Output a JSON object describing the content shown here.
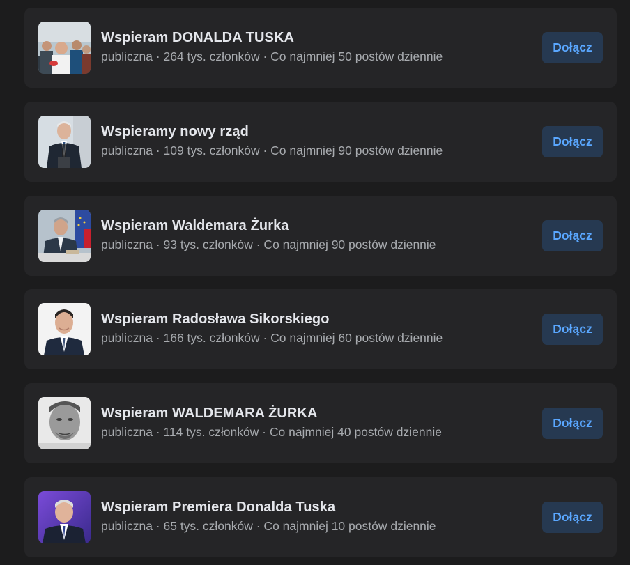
{
  "groups": [
    {
      "name": "Wspieram DONALDA TUSKA",
      "meta": "publiczna · 264 tys. członków · Co najmniej 50 postów dziennie",
      "join_label": "Dołącz",
      "photo": "crowd-photo-icon"
    },
    {
      "name": "Wspieramy nowy rząd",
      "meta": "publiczna · 109 tys. członków · Co najmniej 90 postów dziennie",
      "join_label": "Dołącz",
      "photo": "speaker-at-podium-photo-icon"
    },
    {
      "name": "Wspieram Waldemara Żurka",
      "meta": "publiczna · 93 tys. członków · Co najmniej 90 postów dziennie",
      "join_label": "Dołącz",
      "photo": "man-with-flags-photo-icon"
    },
    {
      "name": "Wspieram Radosława Sikorskiego",
      "meta": "publiczna · 166 tys. członków · Co najmniej 60 postów dziennie",
      "join_label": "Dołącz",
      "photo": "portrait-photo-icon"
    },
    {
      "name": "Wspieram WALDEMARA ŻURKA",
      "meta": "publiczna · 114 tys. członków · Co najmniej 40 postów dziennie",
      "join_label": "Dołącz",
      "photo": "bw-portrait-photo-icon"
    },
    {
      "name": "Wspieram Premiera Donalda Tuska",
      "meta": "publiczna · 65 tys. członków · Co najmniej 10 postów dziennie",
      "join_label": "Dołącz",
      "photo": "purple-background-portrait-photo-icon"
    }
  ],
  "colors": {
    "page_background": "#1c1c1d",
    "card_background": "#252527",
    "title_text": "#e4e6eb",
    "meta_text": "#a8abaf",
    "button_background": "#263951",
    "button_text": "#5aa7ff"
  }
}
